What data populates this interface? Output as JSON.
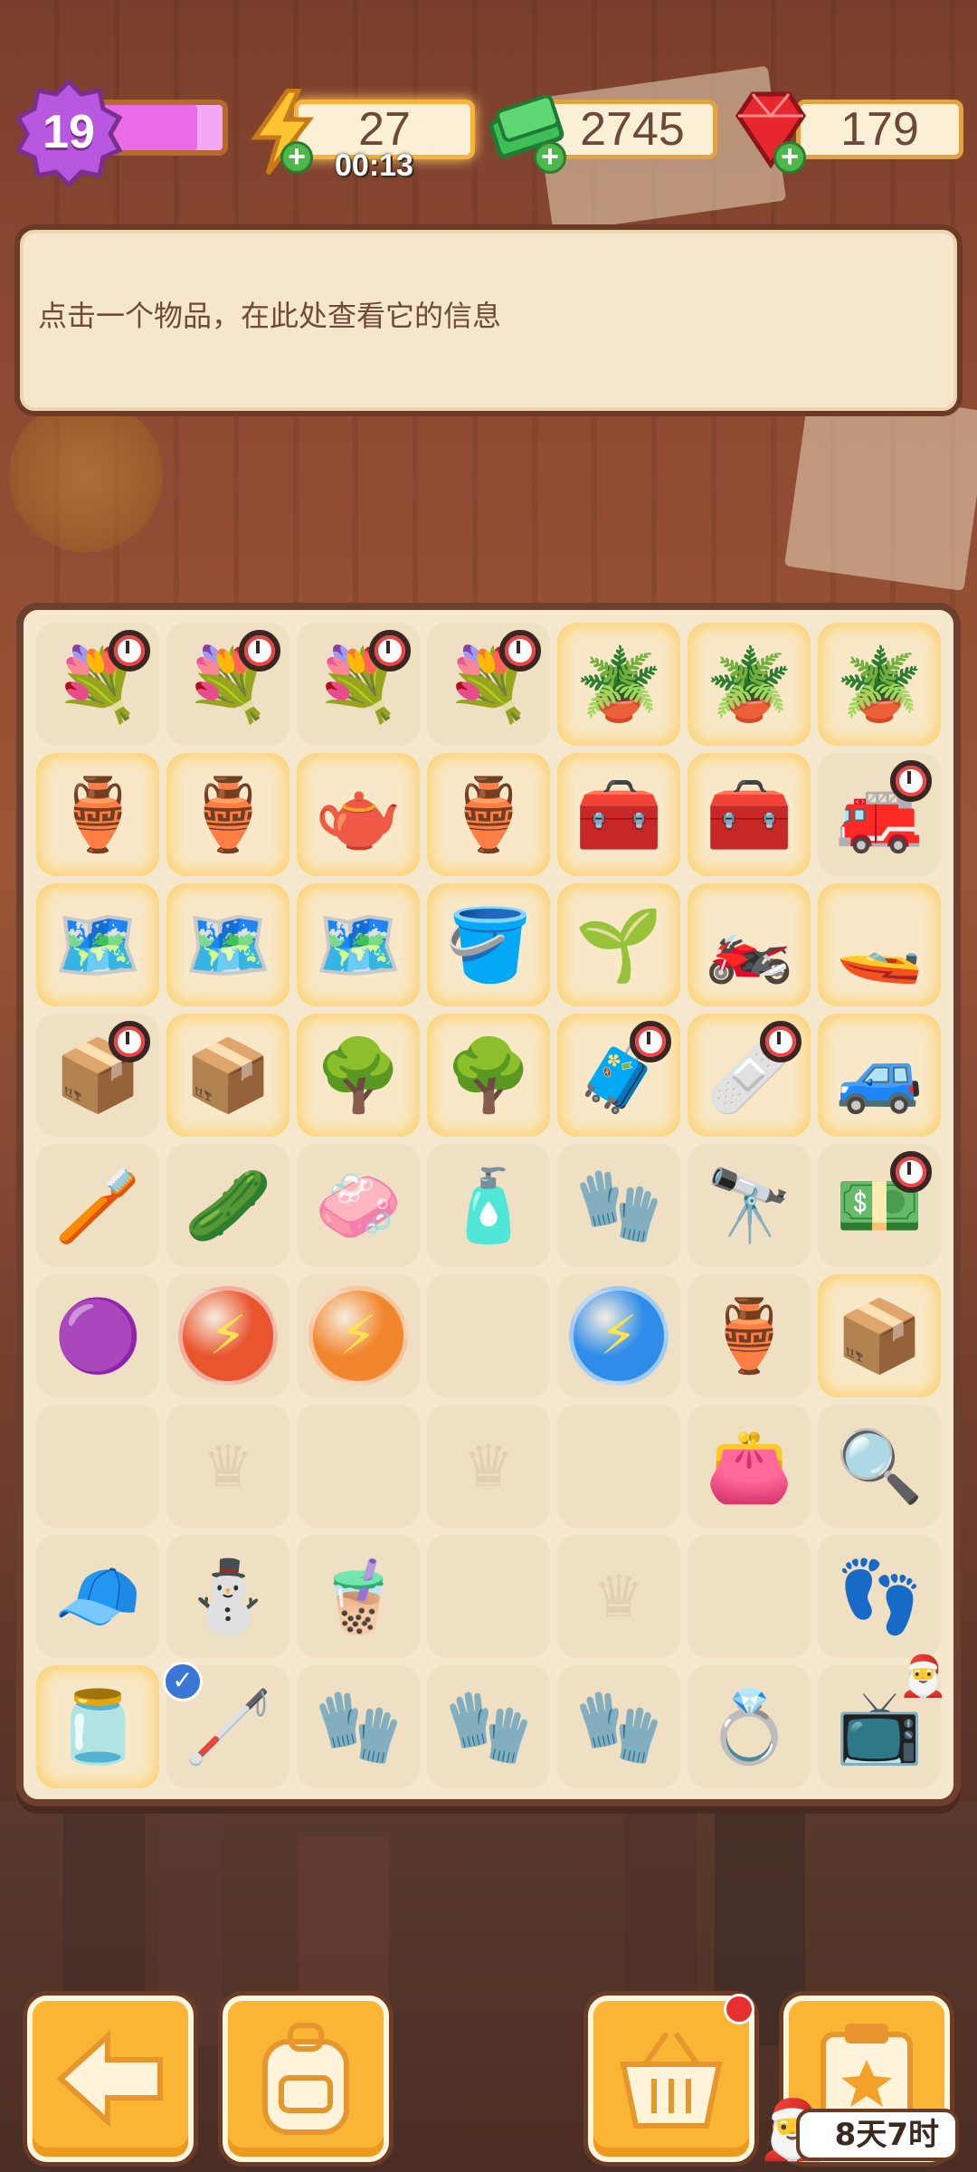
{
  "hud": {
    "level": "19",
    "level_progress": 0.8,
    "energy": "27",
    "energy_timer": "00:13",
    "cash": "2745",
    "gems": "179"
  },
  "info_panel": {
    "text": "点击一个物品，在此处查看它的信息"
  },
  "board": {
    "cells": [
      {
        "icon": "flower-basket-icon",
        "glyph": "💐",
        "glow": false,
        "clock": true
      },
      {
        "icon": "flower-basket-icon",
        "glyph": "💐",
        "glow": false,
        "clock": true
      },
      {
        "icon": "flower-basket-icon",
        "glyph": "💐",
        "glow": false,
        "clock": true
      },
      {
        "icon": "flower-basket-icon",
        "glyph": "💐",
        "glow": false,
        "clock": true
      },
      {
        "icon": "potted-tree-icon",
        "glyph": "🪴",
        "glow": true
      },
      {
        "icon": "potted-tree-icon",
        "glyph": "🪴",
        "glow": true
      },
      {
        "icon": "potted-tree-icon",
        "glyph": "🪴",
        "glow": true
      },
      {
        "icon": "vase-icon",
        "glyph": "🏺",
        "glow": true
      },
      {
        "icon": "vase-icon",
        "glyph": "🏺",
        "glow": true
      },
      {
        "icon": "teapot-icon",
        "glyph": "🫖",
        "glow": true
      },
      {
        "icon": "vase-icon",
        "glyph": "🏺",
        "glow": true
      },
      {
        "icon": "machine-icon",
        "glyph": "🧰",
        "glow": true
      },
      {
        "icon": "machine-icon",
        "glyph": "🧰",
        "glow": true
      },
      {
        "icon": "red-machine-icon",
        "glyph": "🚒",
        "glow": false,
        "clock": true
      },
      {
        "icon": "map-box-icon",
        "glyph": "🗺️",
        "glow": true
      },
      {
        "icon": "map-box-icon",
        "glyph": "🗺️",
        "glow": true
      },
      {
        "icon": "map-box-icon",
        "glyph": "🗺️",
        "glow": true
      },
      {
        "icon": "soil-pot-icon",
        "glyph": "🪣",
        "glow": true
      },
      {
        "icon": "plant-pot-icon",
        "glyph": "🌱",
        "glow": true
      },
      {
        "icon": "motorbike-icon",
        "glyph": "🏍️",
        "glow": true
      },
      {
        "icon": "jetski-icon",
        "glyph": "🚤",
        "glow": true
      },
      {
        "icon": "crate-icon",
        "glyph": "📦",
        "glow": false,
        "clock": true
      },
      {
        "icon": "crate-icon",
        "glyph": "📦",
        "glow": true
      },
      {
        "icon": "bonsai-icon",
        "glyph": "🌳",
        "glow": true
      },
      {
        "icon": "bonsai-icon",
        "glyph": "🌳",
        "glow": true
      },
      {
        "icon": "medical-kit-icon",
        "glyph": "🧳",
        "glow": true,
        "clock": true
      },
      {
        "icon": "first-aid-icon",
        "glyph": "🩹",
        "glow": true,
        "clock": true
      },
      {
        "icon": "purple-car-icon",
        "glyph": "🚙",
        "glow": true
      },
      {
        "icon": "green-brush-icon",
        "glyph": "🪥",
        "glow": false
      },
      {
        "icon": "cucumber-slice-icon",
        "glyph": "🥒",
        "glow": false
      },
      {
        "icon": "soap-bar-icon",
        "glyph": "🧼",
        "glow": false
      },
      {
        "icon": "perfume-bottle-icon",
        "glyph": "🧴",
        "glow": false
      },
      {
        "icon": "green-cloth-icon",
        "glyph": "🧤",
        "glow": false
      },
      {
        "icon": "telescope-icon",
        "glyph": "🔭",
        "glow": false
      },
      {
        "icon": "cash-register-icon",
        "glyph": "💵",
        "glow": false,
        "clock": true
      },
      {
        "icon": "purple-star-icon",
        "glyph": "🟣",
        "glow": false
      },
      {
        "icon": "energy-orb-red-icon",
        "glyph": "⚡",
        "glow": false,
        "orb": "#e9552f"
      },
      {
        "icon": "energy-orb-orange-icon",
        "glyph": "⚡",
        "glow": false,
        "orb": "#f2862e"
      },
      {
        "icon": "empty-cell",
        "glyph": "",
        "glow": false
      },
      {
        "icon": "energy-orb-blue-icon",
        "glyph": "⚡",
        "glow": false,
        "orb": "#2f8de9"
      },
      {
        "icon": "broken-pot-icon",
        "glyph": "🏺",
        "glow": false
      },
      {
        "icon": "closed-box-icon",
        "glyph": "📦",
        "glow": true
      },
      {
        "icon": "empty-cell",
        "glyph": "",
        "glow": false
      },
      {
        "icon": "crown-placeholder-icon",
        "glyph": "♛",
        "glow": false,
        "ghost": true
      },
      {
        "icon": "empty-cell",
        "glyph": "",
        "glow": false
      },
      {
        "icon": "crown-placeholder-icon",
        "glyph": "♛",
        "glow": false,
        "ghost": true
      },
      {
        "icon": "empty-cell",
        "glyph": "",
        "glow": false
      },
      {
        "icon": "wallet-icon",
        "glyph": "👛",
        "glow": false
      },
      {
        "icon": "evidence-bag-icon",
        "glyph": "🔍",
        "glow": false
      },
      {
        "icon": "red-hat-icon",
        "glyph": "🧢",
        "glow": false
      },
      {
        "icon": "snowman-icon",
        "glyph": "⛄",
        "glow": false
      },
      {
        "icon": "bubble-tea-icon",
        "glyph": "🧋",
        "glow": false
      },
      {
        "icon": "empty-cell",
        "glyph": "",
        "glow": false
      },
      {
        "icon": "crown-placeholder-icon",
        "glyph": "♛",
        "glow": false,
        "ghost": true
      },
      {
        "icon": "empty-cell",
        "glyph": "",
        "glow": false
      },
      {
        "icon": "footprint-bag-icon",
        "glyph": "👣",
        "glow": false
      },
      {
        "icon": "glass-jar-icon",
        "glyph": "🫙",
        "glow": true
      },
      {
        "icon": "crutch-icon",
        "glyph": "🦯",
        "glow": false,
        "check": true
      },
      {
        "icon": "red-glove-icon",
        "glyph": "🧤",
        "glow": false
      },
      {
        "icon": "red-glove-icon",
        "glyph": "🧤",
        "glow": false
      },
      {
        "icon": "red-glove-icon",
        "glyph": "🧤",
        "glow": false
      },
      {
        "icon": "yellow-ring-icon",
        "glyph": "💍",
        "glow": false
      },
      {
        "icon": "retro-tv-icon",
        "glyph": "📺",
        "glow": false,
        "santa": true
      }
    ]
  },
  "toolbar": {
    "event_timer": "8天7时"
  },
  "colors": {
    "accent": "#fbb535",
    "panel": "#f6e6cc",
    "border": "#6d3f2e"
  }
}
